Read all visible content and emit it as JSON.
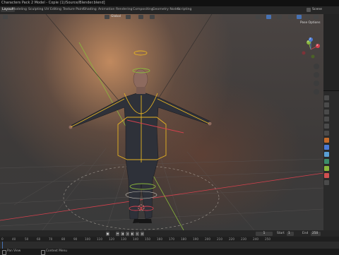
{
  "window": {
    "title": "Characters Pack 2 Model - Copie (1)/Source/Blender.blend]"
  },
  "workspaces": [
    "Layout",
    "Modeling",
    "Sculpting",
    "UV Editing",
    "Texture Paint",
    "Shading",
    "Animation",
    "Rendering",
    "Compositing",
    "Geometry Nodes",
    "Scripting"
  ],
  "active_workspace": "Layout",
  "scene_label": "Scene",
  "viewport": {
    "orientation": "Global",
    "pose_options": "Pose Options",
    "gizmo_x": "X",
    "gizmo_y": "Y",
    "gizmo_z": "Z"
  },
  "timeline": {
    "current_frame": "1",
    "start_label": "Start",
    "start_value": "1",
    "end_label": "End",
    "end_value": "250"
  },
  "ruler_ticks": [
    "0",
    "40",
    "50",
    "60",
    "70",
    "80",
    "90",
    "100",
    "110",
    "120",
    "130",
    "140",
    "150",
    "160",
    "170",
    "180",
    "190",
    "200",
    "210",
    "220",
    "230",
    "240",
    "250"
  ],
  "statusbar": {
    "pan_label": "Pan View",
    "context_label": "Context Menu"
  },
  "colors": {
    "accent": "#4772b3",
    "axis_x": "#d5414e",
    "axis_y": "#8ab83c",
    "axis_z": "#4a7ad6",
    "bone_select": "#e6b422"
  }
}
